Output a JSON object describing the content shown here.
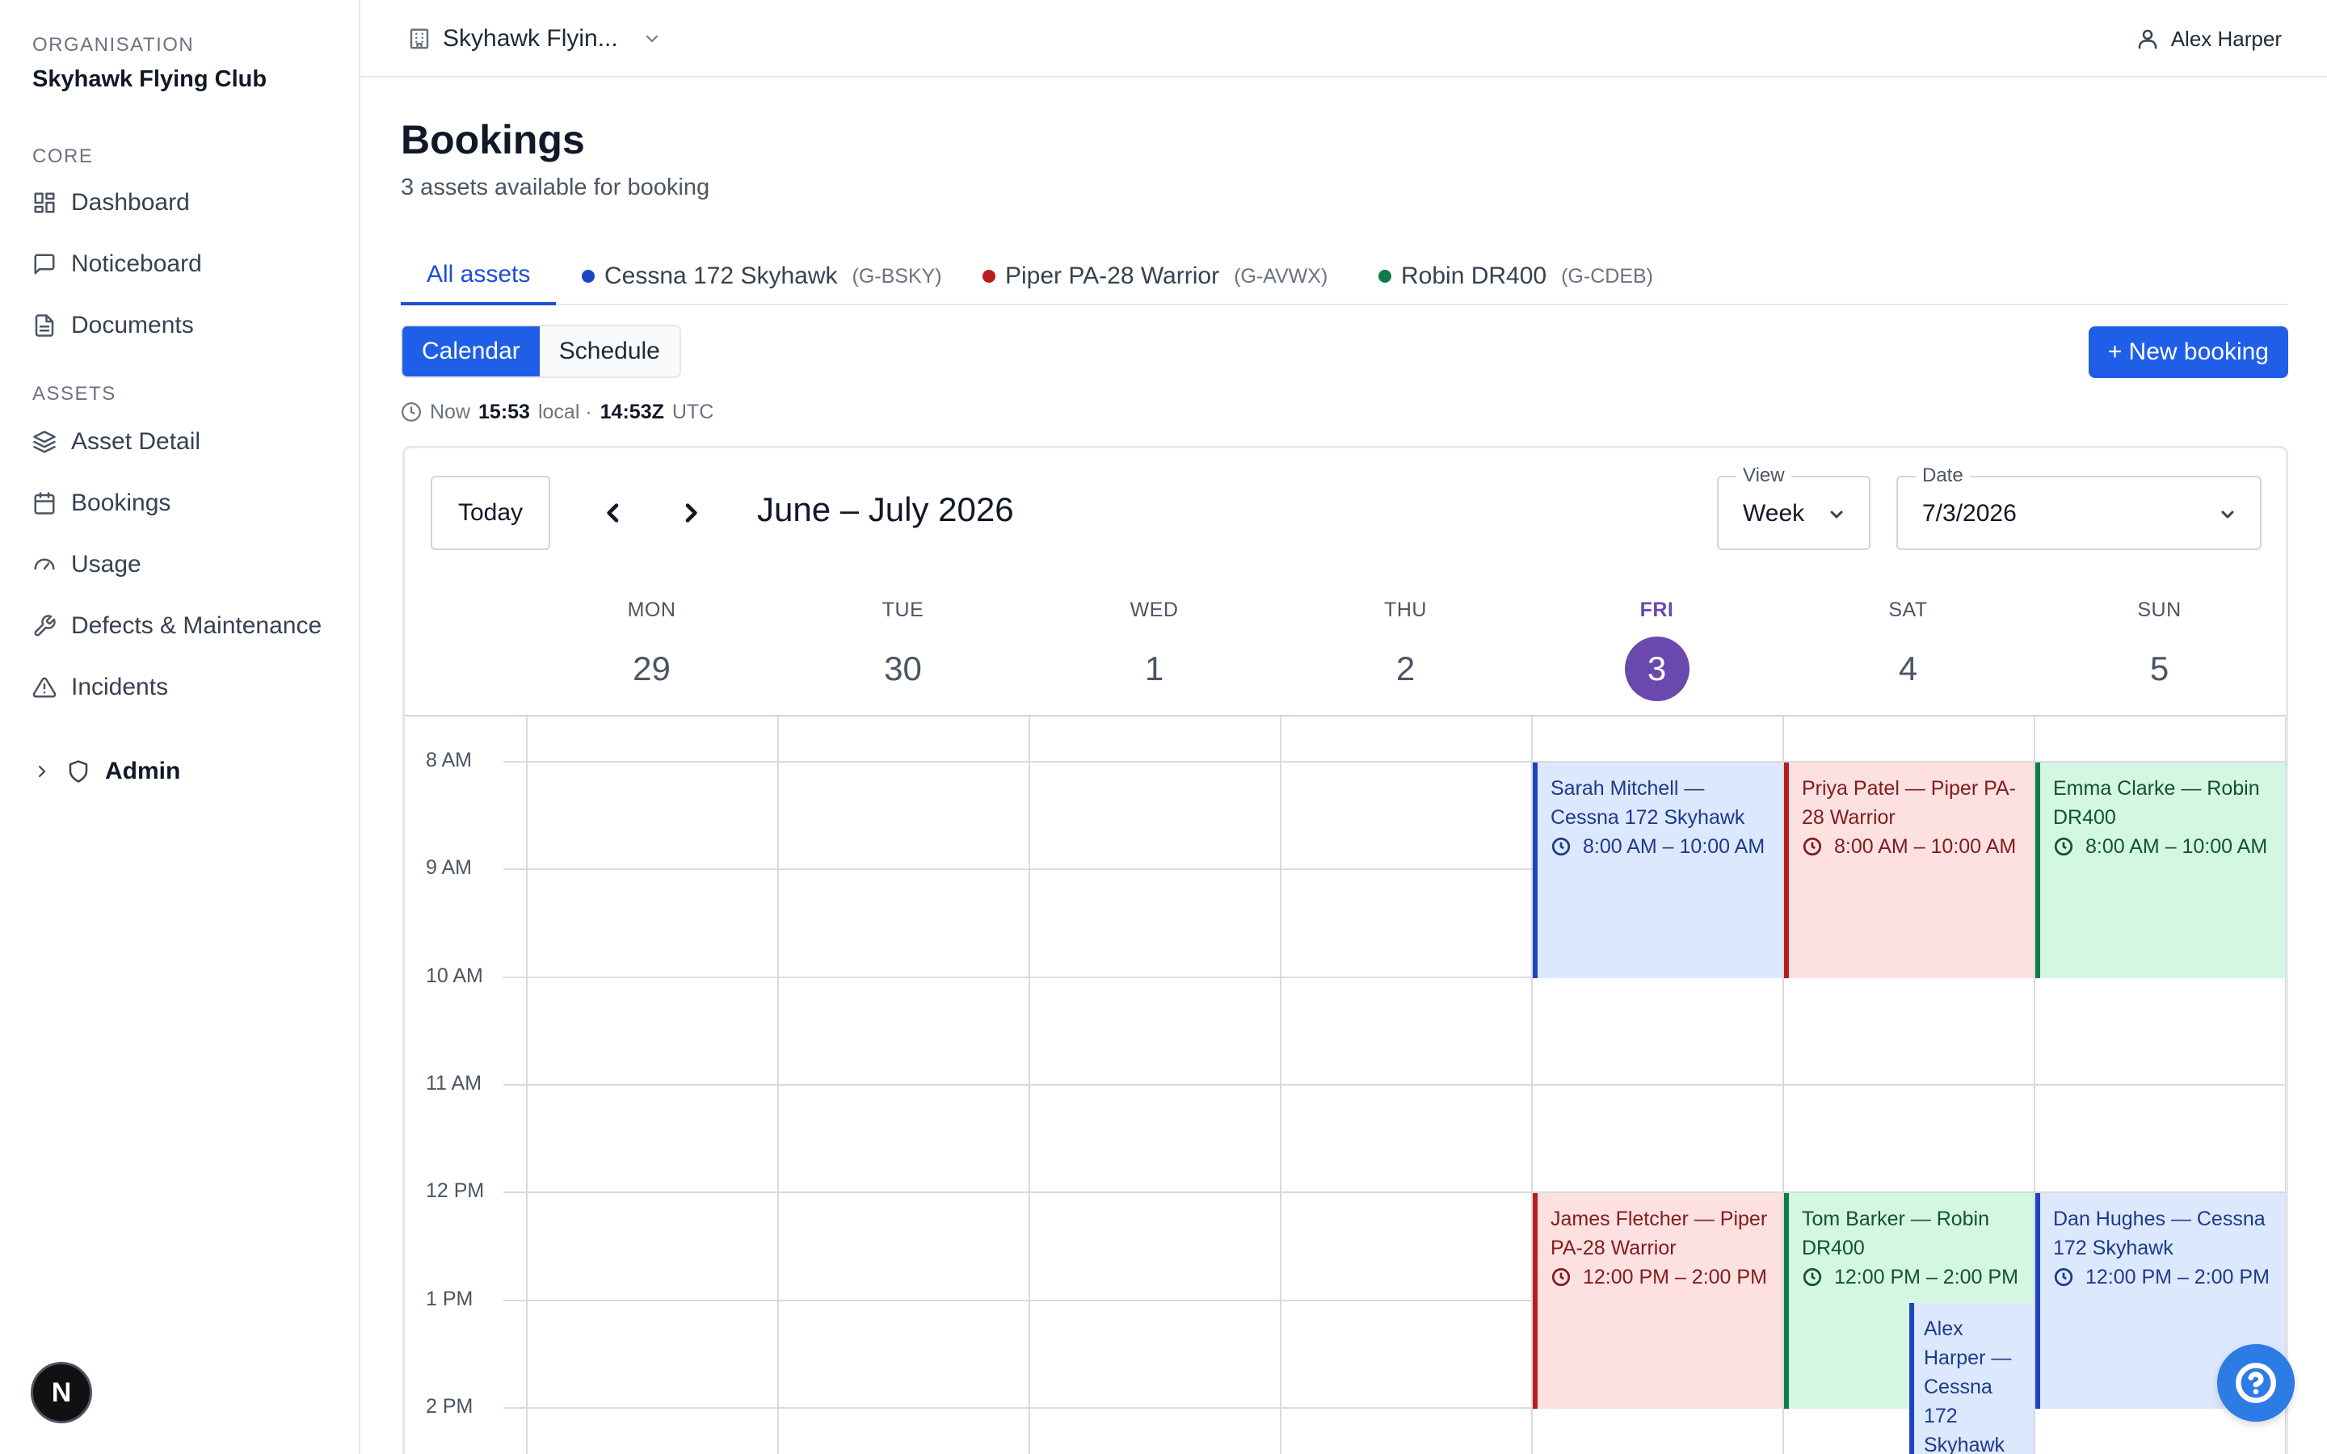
{
  "sidebar": {
    "org_label": "ORGANISATION",
    "org_name": "Skyhawk Flying Club",
    "core_label": "CORE",
    "assets_label": "ASSETS",
    "items": {
      "dashboard": "Dashboard",
      "noticeboard": "Noticeboard",
      "documents": "Documents",
      "asset_detail": "Asset Detail",
      "bookings": "Bookings",
      "usage": "Usage",
      "defects": "Defects & Maintenance",
      "incidents": "Incidents"
    },
    "admin": "Admin",
    "badge": "N"
  },
  "topbar": {
    "org_switch": "Skyhawk Flyin...",
    "user": "Alex Harper"
  },
  "page": {
    "title": "Bookings",
    "subtitle": "3 assets available for booking"
  },
  "tabs": [
    {
      "label": "All assets",
      "reg": "",
      "color": "#1d4ed8"
    },
    {
      "label": "Cessna 172 Skyhawk",
      "reg": "(G-BSKY)",
      "color": "#1d44c2"
    },
    {
      "label": "Piper PA-28 Warrior",
      "reg": "(G-AVWX)",
      "color": "#b91c1c"
    },
    {
      "label": "Robin DR400",
      "reg": "(G-CDEB)",
      "color": "#0f7a4a"
    }
  ],
  "view_toggle": {
    "calendar": "Calendar",
    "schedule": "Schedule"
  },
  "new_booking": "+ New booking",
  "clock": {
    "prefix": "Now",
    "local": "15:53",
    "local_suffix": "local ·",
    "utc": "14:53Z",
    "utc_suffix": "UTC"
  },
  "calendar": {
    "today": "Today",
    "range": "June – July 2026",
    "view_label": "View",
    "view_value": "Week",
    "date_label": "Date",
    "date_value": "7/3/2026",
    "days": [
      {
        "name": "MON",
        "num": "29"
      },
      {
        "name": "TUE",
        "num": "30"
      },
      {
        "name": "WED",
        "num": "1"
      },
      {
        "name": "THU",
        "num": "2"
      },
      {
        "name": "FRI",
        "num": "3"
      },
      {
        "name": "SAT",
        "num": "4"
      },
      {
        "name": "SUN",
        "num": "5"
      }
    ],
    "hours": [
      "8 AM",
      "9 AM",
      "10 AM",
      "11 AM",
      "12 PM",
      "1 PM",
      "2 PM"
    ],
    "events": [
      {
        "title": "Sarah Mitchell — Cessna 172 Skyhawk",
        "time": "8:00 AM – 10:00 AM",
        "day": "FRI",
        "color": "blue"
      },
      {
        "title": "Priya Patel — Piper PA-28 Warrior",
        "time": "8:00 AM – 10:00 AM",
        "day": "SAT",
        "color": "red"
      },
      {
        "title": "Emma Clarke — Robin DR400",
        "time": "8:00 AM – 10:00 AM",
        "day": "SUN",
        "color": "green"
      },
      {
        "title": "James Fletcher — Piper PA-28 Warrior",
        "time": "12:00 PM – 2:00 PM",
        "day": "FRI",
        "color": "red"
      },
      {
        "title": "Tom Barker — Robin DR400",
        "time": "12:00 PM – 2:00 PM",
        "day": "SAT",
        "color": "green"
      },
      {
        "title": "Dan Hughes — Cessna 172 Skyhawk",
        "time": "12:00 PM – 2:00 PM",
        "day": "SUN",
        "color": "blue"
      },
      {
        "title": "Alex Harper — Cessna 172 Skyhawk",
        "time": "",
        "day": "SAT",
        "color": "blue"
      }
    ]
  }
}
